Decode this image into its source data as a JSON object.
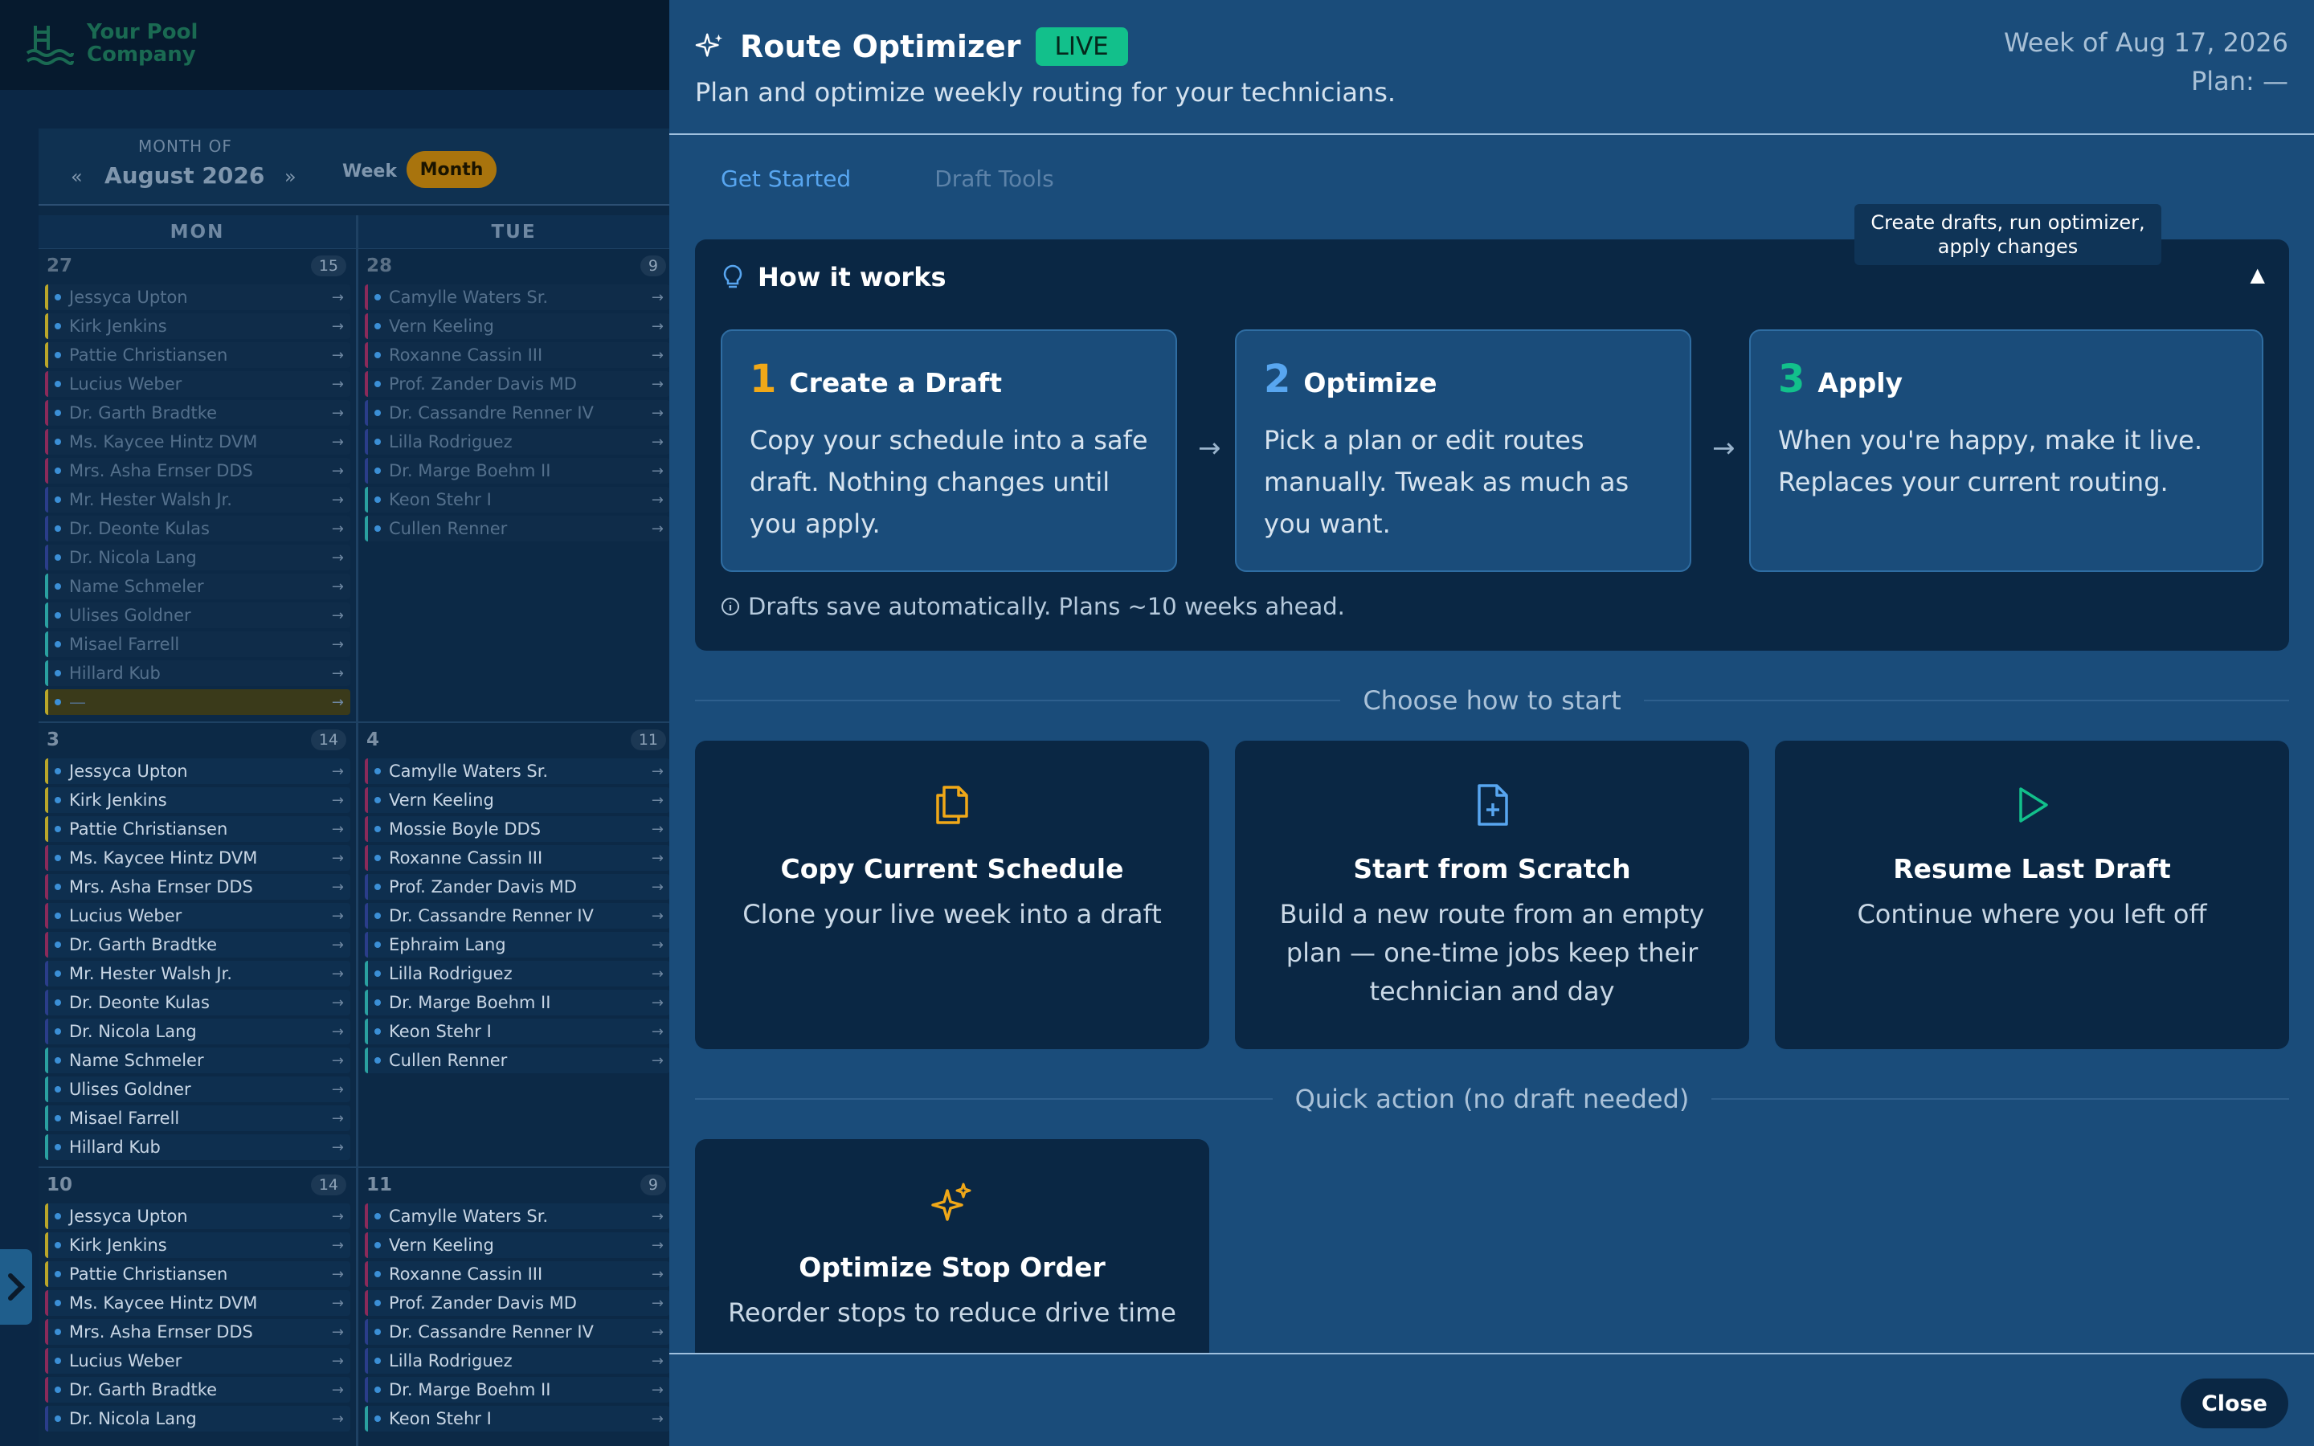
{
  "logo": {
    "line1": "Your Pool",
    "line2": "Company"
  },
  "calendar": {
    "month_of_label": "MONTH OF",
    "month_name": "August 2026",
    "prev": "«",
    "next": "»",
    "view_week": "Week",
    "view_month": "Month",
    "day_headers": [
      "MON",
      "TUE"
    ],
    "weeks": [
      {
        "dim": true,
        "mon": {
          "num": "27",
          "count": "15",
          "items": [
            "Jessyca Upton",
            "Kirk Jenkins",
            "Pattie Christiansen",
            "Lucius Weber",
            "Dr. Garth Bradtke",
            "Ms. Kaycee Hintz DVM",
            "Mrs. Asha Ernser DDS",
            "Mr. Hester Walsh Jr.",
            "Dr. Deonte Kulas",
            "Dr. Nicola Lang",
            "Name Schmeler",
            "Ulises Goldner",
            "Misael Farrell",
            "Hillard Kub",
            "—"
          ]
        },
        "tue": {
          "num": "28",
          "count": "9",
          "items": [
            "Camylle Waters Sr.",
            "Vern Keeling",
            "Roxanne Cassin III",
            "Prof. Zander Davis MD",
            "Dr. Cassandre Renner IV",
            "Lilla Rodriguez",
            "Dr. Marge Boehm II",
            "Keon Stehr I",
            "Cullen Renner"
          ]
        }
      },
      {
        "dim": false,
        "mon": {
          "num": "3",
          "count": "14",
          "items": [
            "Jessyca Upton",
            "Kirk Jenkins",
            "Pattie Christiansen",
            "Ms. Kaycee Hintz DVM",
            "Mrs. Asha Ernser DDS",
            "Lucius Weber",
            "Dr. Garth Bradtke",
            "Mr. Hester Walsh Jr.",
            "Dr. Deonte Kulas",
            "Dr. Nicola Lang",
            "Name Schmeler",
            "Ulises Goldner",
            "Misael Farrell",
            "Hillard Kub"
          ]
        },
        "tue": {
          "num": "4",
          "count": "11",
          "items": [
            "Camylle Waters Sr.",
            "Vern Keeling",
            "Mossie Boyle DDS",
            "Roxanne Cassin III",
            "Prof. Zander Davis MD",
            "Dr. Cassandre Renner IV",
            "Ephraim Lang",
            "Lilla Rodriguez",
            "Dr. Marge Boehm II",
            "Keon Stehr I",
            "Cullen Renner"
          ]
        }
      },
      {
        "dim": false,
        "mon": {
          "num": "10",
          "count": "14",
          "items": [
            "Jessyca Upton",
            "Kirk Jenkins",
            "Pattie Christiansen",
            "Ms. Kaycee Hintz DVM",
            "Mrs. Asha Ernser DDS",
            "Lucius Weber",
            "Dr. Garth Bradtke",
            "Dr. Nicola Lang"
          ]
        },
        "tue": {
          "num": "11",
          "count": "9",
          "items": [
            "Camylle Waters Sr.",
            "Vern Keeling",
            "Roxanne Cassin III",
            "Prof. Zander Davis MD",
            "Dr. Cassandre Renner IV",
            "Lilla Rodriguez",
            "Dr. Marge Boehm II",
            "Keon Stehr I"
          ]
        }
      }
    ]
  },
  "panel": {
    "title": "Route Optimizer",
    "badge": "LIVE",
    "subtitle": "Plan and optimize weekly routing for your technicians.",
    "week": "Week of Aug 17, 2026",
    "plan": "Plan: —",
    "tabs": [
      "Get Started",
      "Draft Tools"
    ],
    "tooltip": "Create drafts, run optimizer, apply changes",
    "how": {
      "title": "How it works",
      "caret": "▲",
      "steps": [
        {
          "num": "1",
          "name": "Create a Draft",
          "desc": "Copy your schedule into a safe draft. Nothing changes until you apply.",
          "color": "#f0a818"
        },
        {
          "num": "2",
          "name": "Optimize",
          "desc": "Pick a plan or edit routes manually. Tweak as much as you want.",
          "color": "#58a6f0"
        },
        {
          "num": "3",
          "name": "Apply",
          "desc": "When you're happy, make it live. Replaces your current routing.",
          "color": "#12c08b"
        }
      ],
      "arrow": "→",
      "note": "Drafts save automatically. Plans ~10 weeks ahead."
    },
    "choose_label": "Choose how to start",
    "start_cards": [
      {
        "icon": "copy-icon",
        "name": "Copy Current Schedule",
        "desc": "Clone your live week into a draft"
      },
      {
        "icon": "new-file-icon",
        "name": "Start from Scratch",
        "desc": "Build a new route from an empty plan — one-time jobs keep their technician and day"
      },
      {
        "icon": "play-icon",
        "name": "Resume Last Draft",
        "desc": "Continue where you left off"
      }
    ],
    "quick_label": "Quick action (no draft needed)",
    "quick_card": {
      "icon": "sparkles-icon",
      "name": "Optimize Stop Order",
      "desc": "Reorder stops to reduce drive time"
    },
    "close": "Close"
  },
  "colors": {
    "accent": "#58a6f0",
    "live": "#12c08b",
    "month": "#a9740d",
    "panel": "#1a4c7a",
    "card": "#0a2744"
  }
}
